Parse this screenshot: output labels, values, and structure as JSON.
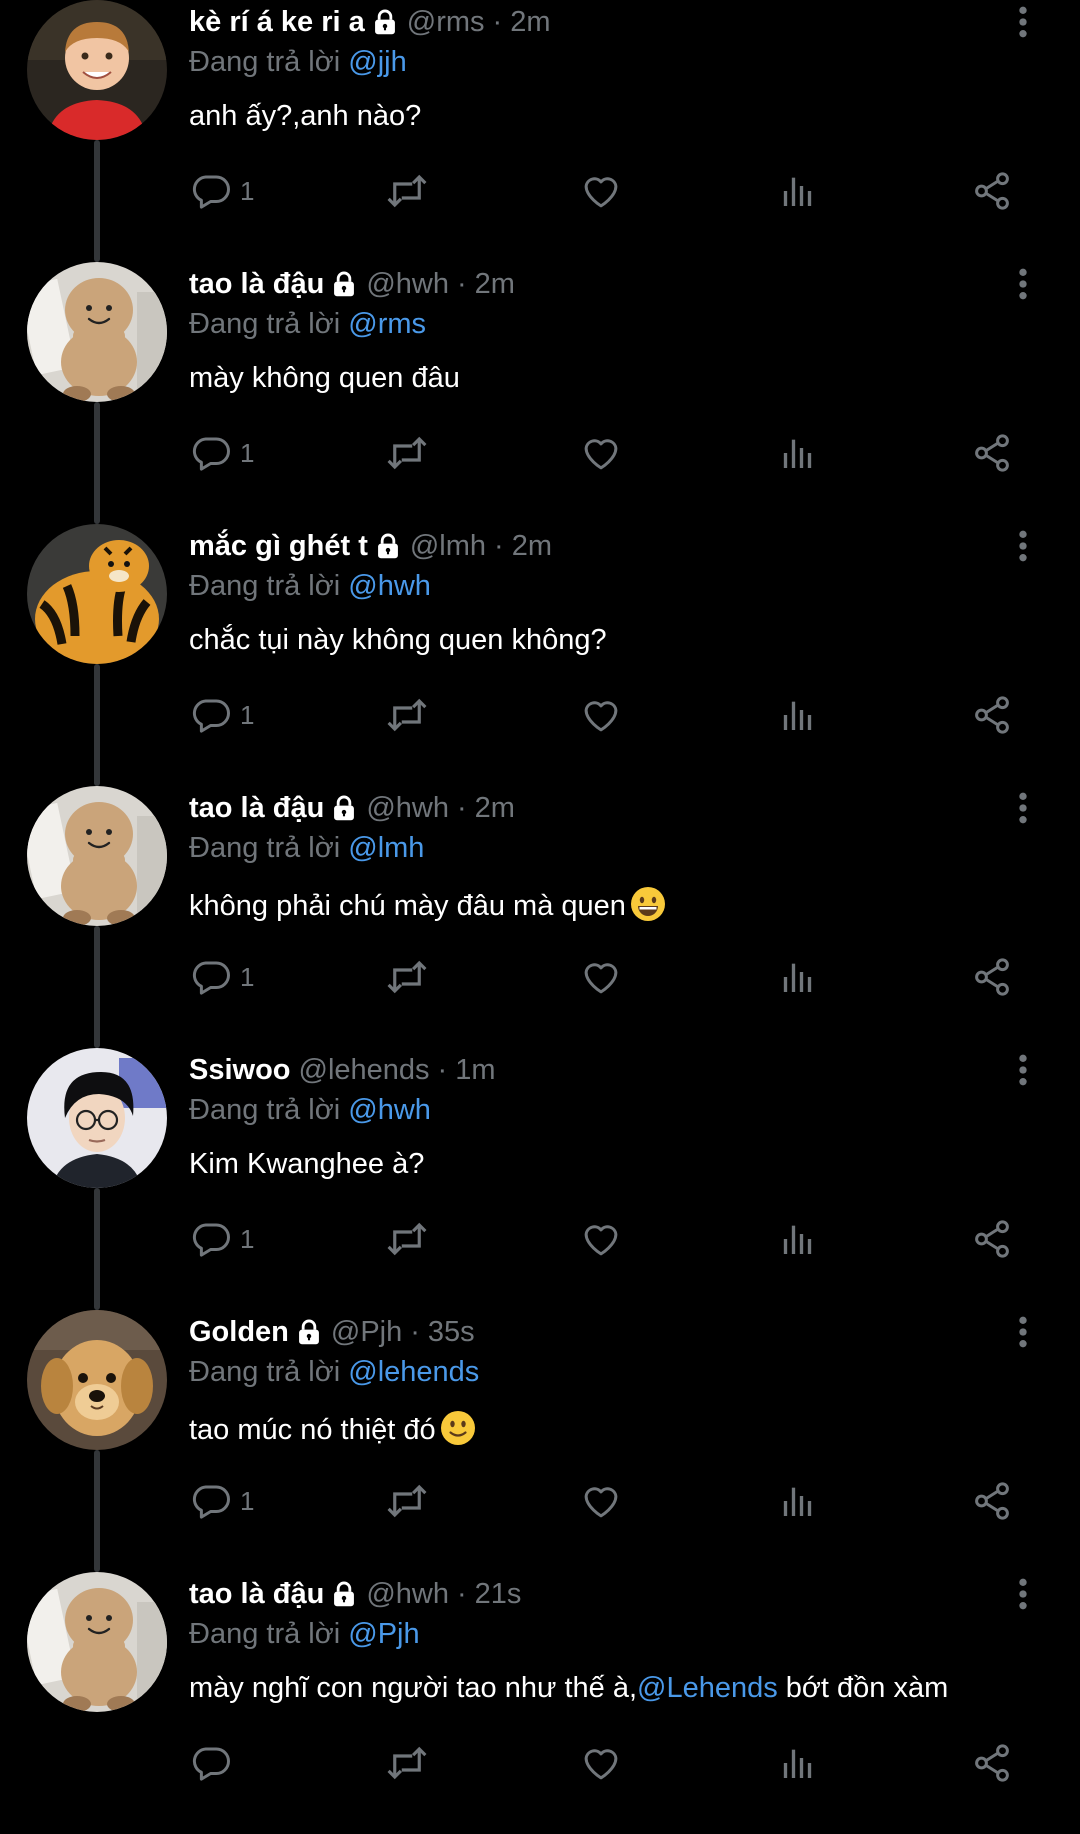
{
  "labels": {
    "replying_prefix": "Đang trả lời"
  },
  "colors": {
    "background": "#000000",
    "name": "#ffffff",
    "secondary": "#71767b",
    "mention": "#4a99e9",
    "thread_line": "#333639"
  },
  "icons": {
    "reply": "reply-icon",
    "retweet": "retweet-icon",
    "like": "heart-icon",
    "views": "views-icon",
    "share": "share-icon",
    "more": "more-vertical-icon",
    "lock": "lock-icon"
  },
  "tweets": [
    {
      "name": "kè rí á ke ri a",
      "protected": true,
      "handle": "@rms",
      "time": "2m",
      "replying_to": "@jjh",
      "text": "anh ấy?,anh nào?",
      "reply_count": "1",
      "avatar": "boy-red-shirt"
    },
    {
      "name": "tao là đậu",
      "protected": true,
      "handle": "@hwh",
      "time": "2m",
      "replying_to": "@rms",
      "text": "mày không quen đâu",
      "reply_count": "1",
      "avatar": "peanut-plush"
    },
    {
      "name": "mắc gì ghét t",
      "protected": true,
      "handle": "@lmh",
      "time": "2m",
      "replying_to": "@hwh",
      "text": "chắc tụi này không quen không?",
      "reply_count": "1",
      "avatar": "tiger-plush"
    },
    {
      "name": "tao là đậu",
      "protected": true,
      "handle": "@hwh",
      "time": "2m",
      "replying_to": "@lmh",
      "text": "không phải chú mày đâu mà quen",
      "emoji": "grinning-face",
      "reply_count": "1",
      "avatar": "peanut-plush"
    },
    {
      "name": "Ssiwoo",
      "protected": false,
      "handle": "@lehends",
      "time": "1m",
      "replying_to": "@hwh",
      "text": "Kim Kwanghee à?",
      "reply_count": "1",
      "avatar": "person-glasses"
    },
    {
      "name": "Golden",
      "protected": true,
      "handle": "@Pjh",
      "time": "35s",
      "replying_to": "@lehends",
      "text": "tao múc nó thiệt đó",
      "emoji": "slightly-smiling-face",
      "reply_count": "1",
      "avatar": "golden-puppy"
    },
    {
      "name": "tao là đậu",
      "protected": true,
      "handle": "@hwh",
      "time": "21s",
      "replying_to": "@Pjh",
      "text": "mày nghĩ con người tao như thế à,",
      "text_mention": "@Lehends",
      "text_after": " bớt đồn xàm",
      "reply_count": "",
      "avatar": "peanut-plush"
    }
  ]
}
